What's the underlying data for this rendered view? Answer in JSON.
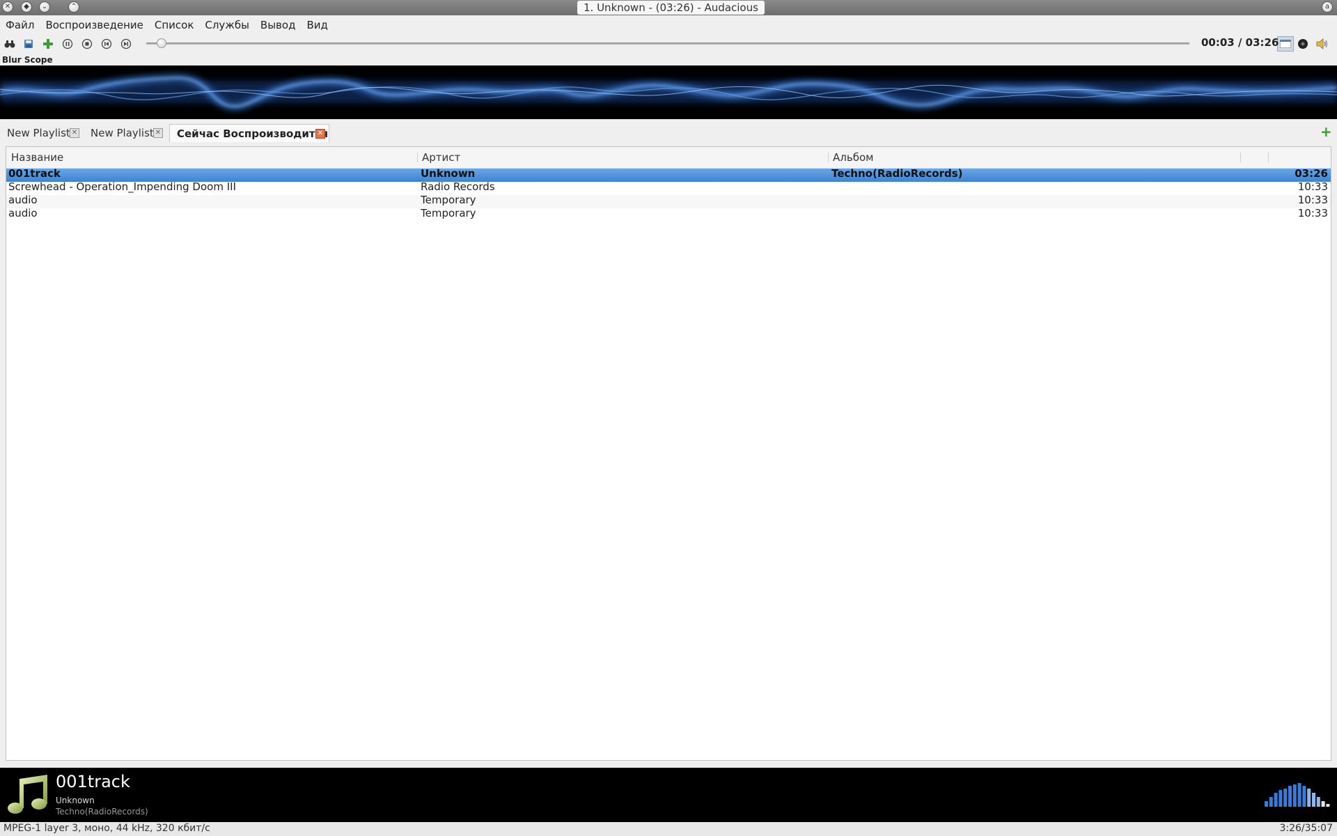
{
  "window": {
    "title": "1. Unknown -  (03:26) - Audacious"
  },
  "menu": {
    "items": [
      "Файл",
      "Воспроизведение",
      "Список",
      "Службы",
      "Вывод",
      "Вид"
    ]
  },
  "toolbar": {
    "icons": [
      "search-icon",
      "open-icon",
      "add-icon",
      "pause-icon",
      "stop-icon",
      "previous-icon",
      "next-icon"
    ],
    "seek_fraction": 0.015,
    "time": "00:03 / 03:26"
  },
  "visualizer": {
    "label": "Blur Scope"
  },
  "tabs": [
    {
      "label": "New Playlist",
      "active": false
    },
    {
      "label": "New Playlist",
      "active": false
    },
    {
      "label": "Сейчас Воспроизводится",
      "active": true
    }
  ],
  "playlist": {
    "columns": {
      "title": "Название",
      "artist": "Артист",
      "album": "Альбом"
    },
    "rows": [
      {
        "title": "001track",
        "artist": "Unknown",
        "album": "Techno(RadioRecords)",
        "length": "03:26",
        "selected": true
      },
      {
        "title": "Screwhead - Operation_Impending Doom III",
        "artist": "Radio Records",
        "album": "",
        "length": "10:33",
        "selected": false
      },
      {
        "title": "audio",
        "artist": "Temporary",
        "album": "",
        "length": "10:33",
        "selected": false
      },
      {
        "title": "audio",
        "artist": "Temporary",
        "album": "",
        "length": "10:33",
        "selected": false
      }
    ]
  },
  "now_playing": {
    "title": "001track",
    "artist": "Unknown",
    "album": "Techno(RadioRecords)"
  },
  "status": {
    "format": "MPEG-1 layer 3, моно, 44 kHz, 320 кбит/с",
    "total": "3:26/35:07"
  },
  "colors": {
    "selection": "#4a90d9",
    "visualizer_glow": "#3a7bd5",
    "add_green": "#3a9e2e"
  }
}
